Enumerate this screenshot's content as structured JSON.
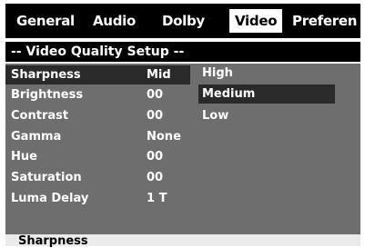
{
  "tabs": [
    {
      "label": "General",
      "active": false
    },
    {
      "label": "Audio",
      "active": false
    },
    {
      "label": "Dolby",
      "active": false
    },
    {
      "label": "Video",
      "active": true
    },
    {
      "label": "Preferen",
      "active": false
    }
  ],
  "title": "-- Video Quality Setup --",
  "settings": [
    {
      "label": "Sharpness",
      "value": "Mid",
      "selected": true
    },
    {
      "label": "Brightness",
      "value": "00",
      "selected": false
    },
    {
      "label": "Contrast",
      "value": "00",
      "selected": false
    },
    {
      "label": "Gamma",
      "value": "None",
      "selected": false
    },
    {
      "label": "Hue",
      "value": "00",
      "selected": false
    },
    {
      "label": "Saturation",
      "value": "00",
      "selected": false
    },
    {
      "label": "Luma Delay",
      "value": "1 T",
      "selected": false
    }
  ],
  "options": [
    {
      "label": "High",
      "selected": false
    },
    {
      "label": "Medium",
      "selected": true
    },
    {
      "label": "Low",
      "selected": false
    }
  ],
  "status": {
    "text": "Sharpness"
  },
  "colors": {
    "bar": "#000000",
    "panel": "#6e6e6e",
    "highlight": "#2a2a2a",
    "text": "#ffffff",
    "status_bg": "#ebebeb"
  }
}
